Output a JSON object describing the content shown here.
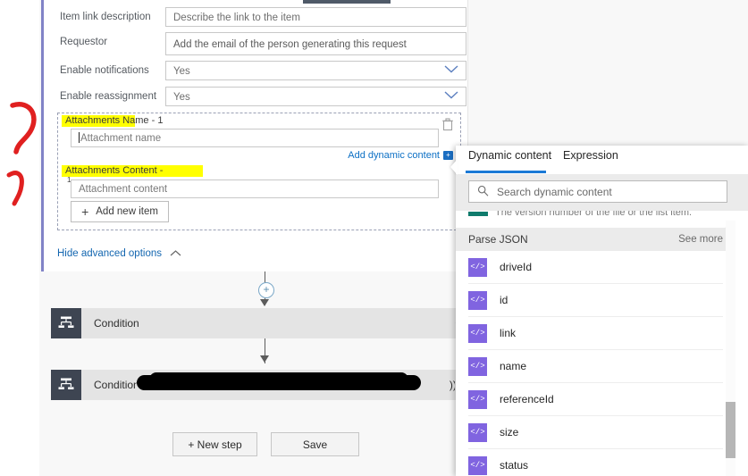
{
  "action_form": {
    "rows": [
      {
        "label": "Item link description",
        "value": "Describe the link to the item",
        "type": "text"
      },
      {
        "label": "Requestor",
        "value": "Add the email of the person generating this request",
        "type": "text"
      },
      {
        "label": "Enable notifications",
        "value": "Yes",
        "type": "select"
      },
      {
        "label": "Enable reassignment",
        "value": "Yes",
        "type": "select"
      }
    ]
  },
  "attachments": {
    "name_label": "Attachments Name - 1",
    "name_placeholder": "Attachment name",
    "add_dynamic_content": "Add dynamic content",
    "dynamic_badge": "+",
    "content_label": "Attachments Content -",
    "content_label_suffix": "1",
    "content_placeholder": "Attachment content",
    "add_new_item": "Add new item",
    "delete_icon": "trash-icon",
    "highlight_color": "#ffff00"
  },
  "advanced": {
    "toggle_label": "Hide advanced options"
  },
  "flow": {
    "steps": [
      {
        "title": "Condition",
        "icon": "condition-icon",
        "redacted": false
      },
      {
        "title": "Condition - ",
        "title_suffix": "))",
        "icon": "condition-icon",
        "redacted": true
      }
    ],
    "add_step_node": "+"
  },
  "footer": {
    "new_step": "+ New step",
    "save": "Save"
  },
  "dynamic_panel": {
    "tabs": [
      {
        "label": "Dynamic content",
        "selected": true
      },
      {
        "label": "Expression",
        "selected": false
      }
    ],
    "search_placeholder": "Search dynamic content",
    "search_value": "",
    "search_icon": "search-icon",
    "clipped_description": "The version number of the file or the list item.",
    "group": {
      "title": "Parse JSON",
      "see_more": "See more"
    },
    "items": [
      {
        "name": "driveId",
        "chip": "</>"
      },
      {
        "name": "id",
        "chip": "</>"
      },
      {
        "name": "link",
        "chip": "</>"
      },
      {
        "name": "name",
        "chip": "</>"
      },
      {
        "name": "referenceId",
        "chip": "</>"
      },
      {
        "name": "size",
        "chip": "</>"
      },
      {
        "name": "status",
        "chip": "</>"
      }
    ],
    "accent_color": "#1b7ad6",
    "chip_color": "#8064e0"
  },
  "annotations": {
    "marks": [
      {
        "shape": "question-mark-stroke",
        "color": "#e02020"
      },
      {
        "shape": "hook-stroke",
        "color": "#e02020"
      }
    ]
  }
}
